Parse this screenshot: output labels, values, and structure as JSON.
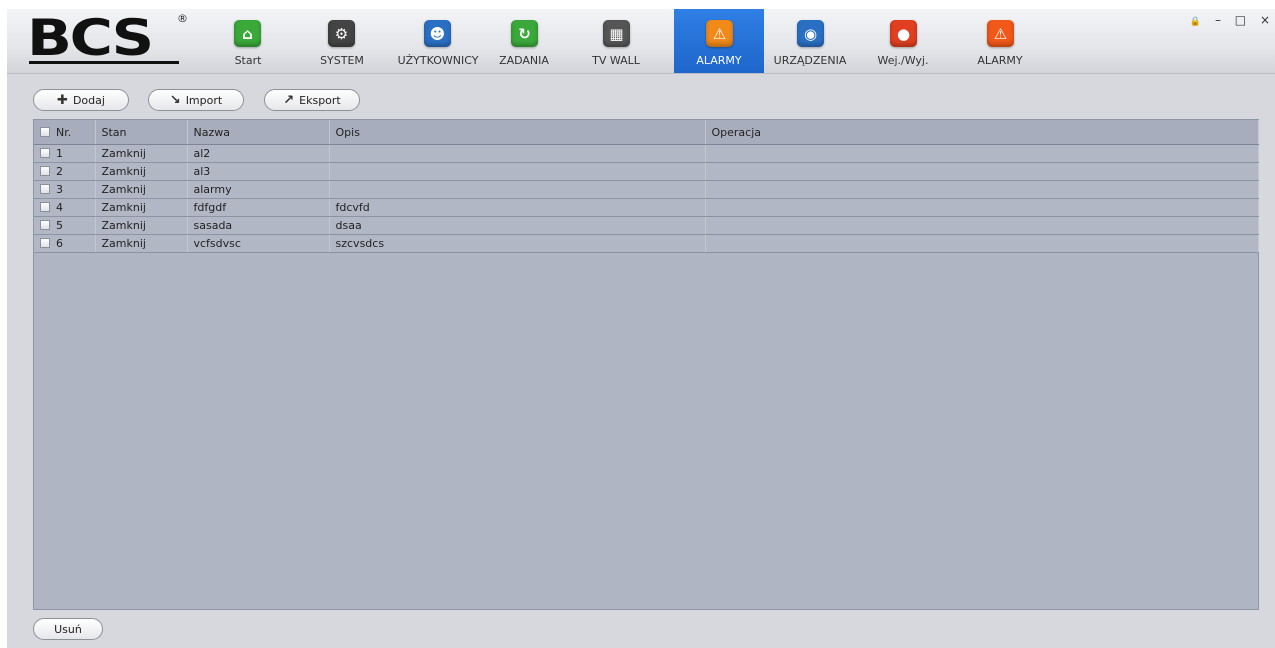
{
  "brand": {
    "logo_text": "BCS",
    "registered": "®"
  },
  "nav": {
    "items": [
      {
        "label": "Start",
        "icon": "home-icon",
        "color": "#3aa93a",
        "glyph": "⌂"
      },
      {
        "label": "SYSTEM",
        "icon": "gears-icon",
        "color": "#444444",
        "glyph": "⚙"
      },
      {
        "label": "UŻYTKOWNICY",
        "icon": "user-icon",
        "color": "#2a6fc4",
        "glyph": "☻"
      },
      {
        "label": "ZADANIA",
        "icon": "refresh-gear-icon",
        "color": "#3aa93a",
        "glyph": "↻"
      },
      {
        "label": "TV WALL",
        "icon": "tv-wall-icon",
        "color": "#555555",
        "glyph": "▦"
      },
      {
        "label": "ALARMY",
        "icon": "alarm-warning-icon",
        "color": "#f28a1a",
        "glyph": "⚠",
        "active": true
      },
      {
        "label": "URZĄDZENIA",
        "icon": "camera-device-icon",
        "color": "#2a6fc4",
        "glyph": "◉"
      },
      {
        "label": "Wej./Wyj.",
        "icon": "siren-icon",
        "color": "#e04020",
        "glyph": "●"
      },
      {
        "label": "ALARMY",
        "icon": "warning-icon",
        "color": "#f2581a",
        "glyph": "⚠"
      }
    ]
  },
  "window_controls": {
    "lock": "🔒",
    "minimize": "–",
    "maximize": "□",
    "close": "×"
  },
  "toolbar": {
    "add_label": "Dodaj",
    "import_label": "Import",
    "export_label": "Eksport"
  },
  "table": {
    "columns": [
      "Nr.",
      "Stan",
      "Nazwa",
      "Opis",
      "Operacja"
    ],
    "rows": [
      {
        "nr": "1",
        "stan": "Zamknij",
        "nazwa": "al2",
        "opis": "",
        "operacja": ""
      },
      {
        "nr": "2",
        "stan": "Zamknij",
        "nazwa": "al3",
        "opis": "",
        "operacja": ""
      },
      {
        "nr": "3",
        "stan": "Zamknij",
        "nazwa": "alarmy",
        "opis": "",
        "operacja": ""
      },
      {
        "nr": "4",
        "stan": "Zamknij",
        "nazwa": "fdfgdf",
        "opis": "fdcvfd",
        "operacja": ""
      },
      {
        "nr": "5",
        "stan": "Zamknij",
        "nazwa": "sasada",
        "opis": "dsaa",
        "operacja": ""
      },
      {
        "nr": "6",
        "stan": "Zamknij",
        "nazwa": "vcfsdvsc",
        "opis": "szcvsdcs",
        "operacja": ""
      }
    ]
  },
  "footer": {
    "delete_label": "Usuń"
  }
}
